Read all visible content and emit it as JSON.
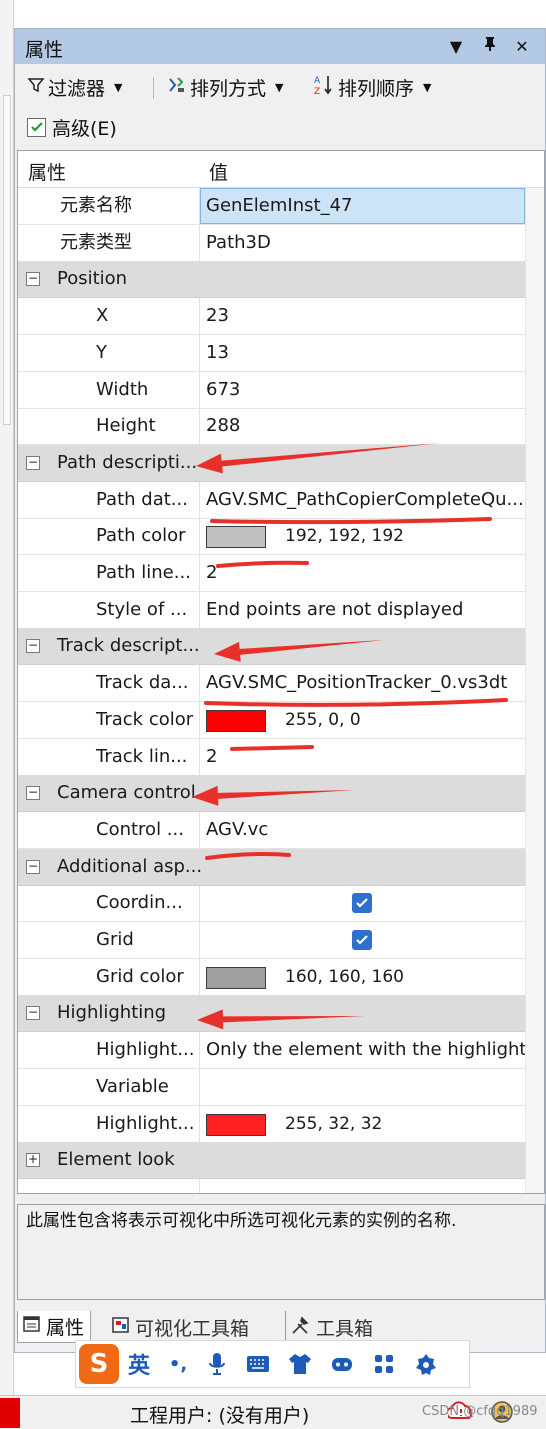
{
  "panel": {
    "title": "属性",
    "pin_glyph": "▼",
    "dock_glyph": "ᛏ",
    "close_glyph": "✕"
  },
  "toolbar": {
    "filter_label": "过滤器",
    "arrange_label": "排列方式",
    "order_label": "排列顺序",
    "advanced_label": "高级(E)",
    "advanced_checked": true
  },
  "grid": {
    "header_property": "属性",
    "header_value": "值",
    "rows": [
      {
        "kind": "prop",
        "name": "元素名称",
        "value": "GenElemInst_47",
        "indent": 1,
        "selected": true
      },
      {
        "kind": "prop",
        "name": "元素类型",
        "value": "Path3D",
        "indent": 1
      },
      {
        "kind": "cat",
        "name": "Position",
        "toggle": "−"
      },
      {
        "kind": "prop",
        "name": "X",
        "value": "23",
        "indent": 2
      },
      {
        "kind": "prop",
        "name": "Y",
        "value": "13",
        "indent": 2
      },
      {
        "kind": "prop",
        "name": "Width",
        "value": "673",
        "indent": 2
      },
      {
        "kind": "prop",
        "name": "Height",
        "value": "288",
        "indent": 2
      },
      {
        "kind": "cat",
        "name": "Path descripti...",
        "toggle": "−"
      },
      {
        "kind": "prop",
        "name": "Path dat...",
        "value": "AGV.SMC_PathCopierCompleteQu...",
        "indent": 2
      },
      {
        "kind": "color",
        "name": "Path color",
        "value": "192, 192, 192",
        "color": "#c0c0c0",
        "indent": 2
      },
      {
        "kind": "prop",
        "name": "Path line...",
        "value": "2",
        "indent": 2
      },
      {
        "kind": "prop",
        "name": "Style of ...",
        "value": "End points are not displayed",
        "indent": 2
      },
      {
        "kind": "cat",
        "name": "Track descript...",
        "toggle": "−"
      },
      {
        "kind": "prop",
        "name": "Track da...",
        "value": "AGV.SMC_PositionTracker_0.vs3dt",
        "indent": 2
      },
      {
        "kind": "color",
        "name": "Track color",
        "value": "255, 0, 0",
        "color": "#ff0000",
        "indent": 2
      },
      {
        "kind": "prop",
        "name": "Track lin...",
        "value": "2",
        "indent": 2
      },
      {
        "kind": "cat",
        "name": "Camera control",
        "toggle": "−"
      },
      {
        "kind": "prop",
        "name": "Control ...",
        "value": "AGV.vc",
        "indent": 2
      },
      {
        "kind": "cat",
        "name": "Additional asp...",
        "toggle": "−"
      },
      {
        "kind": "check",
        "name": "Coordin...",
        "checked": true,
        "indent": 2
      },
      {
        "kind": "check",
        "name": "Grid",
        "checked": true,
        "indent": 2
      },
      {
        "kind": "color",
        "name": "Grid color",
        "value": "160, 160, 160",
        "color": "#a0a0a0",
        "indent": 2
      },
      {
        "kind": "cat",
        "name": "Highlighting",
        "toggle": "−"
      },
      {
        "kind": "prop",
        "name": "Highlight...",
        "value": "Only the element with the highlight...",
        "indent": 2
      },
      {
        "kind": "prop",
        "name": "Variable",
        "value": "",
        "indent": 2
      },
      {
        "kind": "color",
        "name": "Highlight...",
        "value": "255, 32, 32",
        "color": "#ff2020",
        "indent": 2
      },
      {
        "kind": "cat",
        "name": "Element look",
        "toggle": "+"
      }
    ]
  },
  "description": "此属性包含将表示可视化中所选可视化元素的实例的名称.",
  "tabs": [
    {
      "label": "属性",
      "active": true
    },
    {
      "label": "可视化工具箱",
      "active": false
    },
    {
      "label": "工具箱",
      "active": false
    }
  ],
  "ime": {
    "logo": "S",
    "lang": "英",
    "punct": "•,"
  },
  "status": {
    "user_text": "工程用户: (没有用户)",
    "watermark": "CSDN @cfqq1989"
  },
  "colors": {
    "title_bar": "#b4c9e4",
    "selection": "#cde3f7",
    "annotation": "#e8302a",
    "checkbox": "#2e6fcf"
  }
}
